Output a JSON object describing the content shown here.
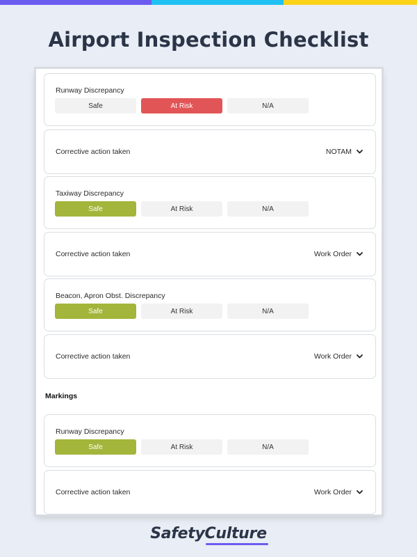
{
  "page": {
    "title": "Airport Inspection Checklist"
  },
  "brand": {
    "name": "SafetyCulture",
    "accent": "#6b5cf0"
  },
  "colors": {
    "background": "#e9edf5",
    "at_risk_selected": "#e25557",
    "safe_selected": "#a3b53a",
    "option_default": "#f2f2f2",
    "top_bar": [
      "#6b5cf0",
      "#1fc0f2",
      "#ffd21a"
    ]
  },
  "options": {
    "safe": "Safe",
    "at_risk": "At Risk",
    "na": "N/A"
  },
  "checklist": {
    "q1": {
      "label": "Runway Discrepancy",
      "selected": "At Risk"
    },
    "a1": {
      "label": "Corrective action taken",
      "value": "NOTAM"
    },
    "q2": {
      "label": "Taxiway Discrepancy",
      "selected": "Safe"
    },
    "a2": {
      "label": "Corrective action taken",
      "value": "Work Order"
    },
    "q3": {
      "label": "Beacon, Apron Obst. Discrepancy",
      "selected": "Safe"
    },
    "a3": {
      "label": "Corrective action taken",
      "value": "Work Order"
    },
    "section": {
      "heading": "Markings"
    },
    "q4": {
      "label": "Runway Discrepancy",
      "selected": "Safe"
    },
    "a4": {
      "label": "Corrective action taken",
      "value": "Work Order"
    }
  },
  "icons": {
    "dropdown": "chevron-down-icon"
  }
}
